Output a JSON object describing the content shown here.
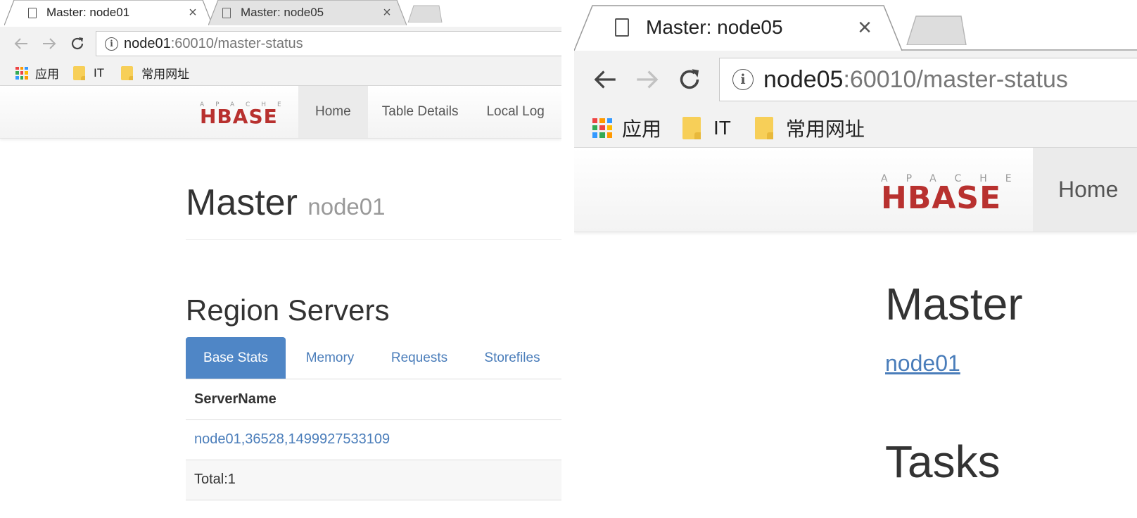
{
  "left": {
    "tabs": [
      {
        "title": "Master: node01",
        "close": "×"
      },
      {
        "title": "Master: node05",
        "close": "×"
      }
    ],
    "address": {
      "host": "node01",
      "path": ":60010/master-status"
    },
    "bookmarks": {
      "apps": "应用",
      "folders": [
        "IT",
        "常用网址"
      ]
    },
    "logo": {
      "top": "APACHE",
      "main": "HBASE"
    },
    "nav": [
      "Home",
      "Table Details",
      "Local Log"
    ],
    "page": {
      "title": "Master",
      "host": "node01",
      "section": "Region Servers",
      "tabs": [
        "Base Stats",
        "Memory",
        "Requests",
        "Storefiles"
      ],
      "table": {
        "header": "ServerName",
        "rows": [
          "node01,36528,1499927533109"
        ],
        "total": "Total:1"
      }
    }
  },
  "right": {
    "tabs": [
      {
        "title": "Master: node05",
        "close": "×"
      }
    ],
    "address": {
      "host": "node05",
      "path": ":60010/master-status"
    },
    "bookmarks": {
      "apps": "应用",
      "folders": [
        "IT",
        "常用网址"
      ]
    },
    "logo": {
      "top": "APACHE",
      "main": "HBASE"
    },
    "nav": [
      "Home"
    ],
    "page": {
      "title": "Master",
      "link": "node01",
      "tasks": "Tasks"
    }
  },
  "colors": {
    "accent": "#4f86c6",
    "link": "#4a7dba",
    "hbase_red": "#b8312f"
  }
}
